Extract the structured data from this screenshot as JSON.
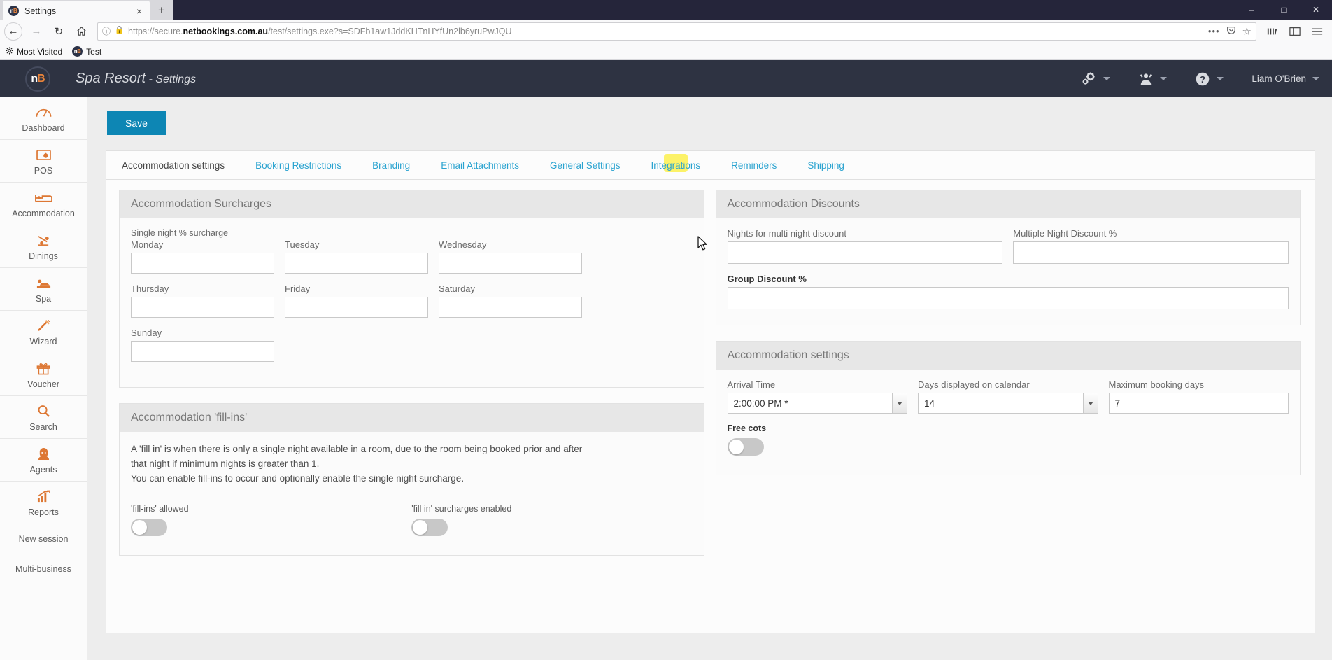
{
  "browser": {
    "tab": {
      "title": "Settings",
      "favicon": "nb-logo-icon",
      "close": "×"
    },
    "newtab_label": "+",
    "window_controls": {
      "minimize": "–",
      "maximize": "□",
      "close": "✕"
    },
    "nav": {
      "back": "←",
      "forward": "→",
      "reload": "↻",
      "home": "⌂"
    },
    "url": {
      "scheme": "https://secure.",
      "domain": "netbookings.com.au",
      "path": "/test/settings.exe?s=SDFb1aw1JddKHTnHYfUn2lb6yruPwJQU",
      "full": "https://secure.netbookings.com.au/test/settings.exe?s=SDFb1aw1JddKHTnHYfUn2lb6yruPwJQU",
      "info_icon": "page-info-icon",
      "warning_icon": "insecure-lock-warning-icon",
      "menu_icon": "•••",
      "pocket_icon": "pocket-icon",
      "star_icon": "☆"
    },
    "toolbar_right": {
      "library": "library-icon",
      "sidebars": "sidebar-icon",
      "menu": "hamburger-menu-icon"
    },
    "bookmarks": [
      {
        "label": "Most Visited",
        "icon": "gear-icon"
      },
      {
        "label": "Test",
        "icon": "nb-logo-icon"
      }
    ]
  },
  "app": {
    "logo": "nb-logo-icon",
    "business": "Spa Resort",
    "separator": " - ",
    "section": "Settings",
    "header_actions": [
      {
        "name": "settings-gears",
        "icon": "gears-icon"
      },
      {
        "name": "user-admin",
        "icon": "person-icon"
      },
      {
        "name": "help",
        "icon": "question-circle-icon"
      }
    ],
    "user": "Liam O'Brien"
  },
  "sidebar": {
    "items": [
      {
        "label": "Dashboard",
        "icon": "gauge-icon"
      },
      {
        "label": "POS",
        "icon": "pos-terminal-icon"
      },
      {
        "label": "Accommodation",
        "icon": "bed-icon"
      },
      {
        "label": "Dinings",
        "icon": "dining-icon"
      },
      {
        "label": "Spa",
        "icon": "massage-icon"
      },
      {
        "label": "Wizard",
        "icon": "magic-wand-icon"
      },
      {
        "label": "Voucher",
        "icon": "gift-icon"
      },
      {
        "label": "Search",
        "icon": "magnifier-icon"
      },
      {
        "label": "Agents",
        "icon": "agent-person-icon"
      },
      {
        "label": "Reports",
        "icon": "bar-chart-up-icon"
      }
    ],
    "links": [
      {
        "label": "New session"
      },
      {
        "label": "Multi-business"
      }
    ]
  },
  "toolbar": {
    "save_label": "Save"
  },
  "tabs": [
    {
      "label": "Accommodation settings",
      "active": true
    },
    {
      "label": "Booking Restrictions",
      "active": false
    },
    {
      "label": "Branding",
      "active": false
    },
    {
      "label": "Email Attachments",
      "active": false
    },
    {
      "label": "General Settings",
      "active": false
    },
    {
      "label": "Integrations",
      "active": false,
      "highlighted": true
    },
    {
      "label": "Reminders",
      "active": false
    },
    {
      "label": "Shipping",
      "active": false
    }
  ],
  "surcharges": {
    "title": "Accommodation Surcharges",
    "section_label": "Single night % surcharge",
    "days": [
      {
        "label": "Monday",
        "value": ""
      },
      {
        "label": "Tuesday",
        "value": ""
      },
      {
        "label": "Wednesday",
        "value": ""
      },
      {
        "label": "Thursday",
        "value": ""
      },
      {
        "label": "Friday",
        "value": ""
      },
      {
        "label": "Saturday",
        "value": ""
      },
      {
        "label": "Sunday",
        "value": ""
      }
    ]
  },
  "fillins": {
    "title": "Accommodation 'fill-ins'",
    "description_line1": "A 'fill in' is when there is only a single night available in a room, due to the room being booked prior and after",
    "description_line2": "that night if minimum nights is greater than 1.",
    "description_line3": "You can enable fill-ins to occur and optionally enable the single night surcharge.",
    "toggle_allowed_label": "'fill-ins' allowed",
    "toggle_allowed_state": "off",
    "toggle_surcharges_label": "'fill in' surcharges enabled",
    "toggle_surcharges_state": "off"
  },
  "discounts": {
    "title": "Accommodation Discounts",
    "nights_label": "Nights for multi night discount",
    "nights_value": "",
    "multi_label": "Multiple Night Discount %",
    "multi_value": "",
    "group_label": "Group Discount %",
    "group_value": ""
  },
  "accom_settings": {
    "title": "Accommodation settings",
    "arrival_label": "Arrival Time",
    "arrival_value": "2:00:00 PM *",
    "days_label": "Days displayed on calendar",
    "days_value": "14",
    "max_label": "Maximum booking days",
    "max_value": "7",
    "cots_label": "Free cots",
    "cots_state": "off"
  },
  "colors": {
    "accent_save": "#0d86b4",
    "header_bg": "#2e3342",
    "sidebar_icon": "#dd7733",
    "tab_link": "#2aa3d0",
    "highlight": "#fcf04e"
  }
}
